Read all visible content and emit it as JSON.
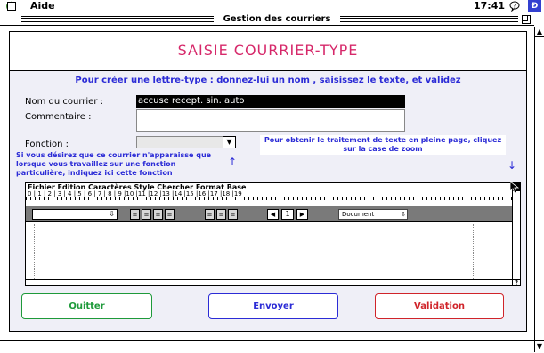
{
  "menubar": {
    "menu_aide": "Aide",
    "clock": "17:41",
    "app_icon_label": "Ð"
  },
  "window": {
    "title": "Gestion des courriers"
  },
  "form": {
    "title": "SAISIE COURRIER-TYPE",
    "instruction": "Pour créer une lettre-type :  donnez-lui un nom , saisissez le texte, et validez",
    "nom_label": "Nom du courrier :",
    "nom_value": "accuse recept. sin. auto",
    "commentaire_label": "Commentaire :",
    "commentaire_value": "",
    "fonction_label": "Fonction :",
    "fonction_value": "",
    "help_left": "Si vous désirez que ce courrier n'apparaisse que lorsque vous travaillez sur une fonction particulière, indiquez ici cette fonction",
    "help_right": "Pour obtenir le traitement de texte en pleine page, cliquez sur la case de zoom"
  },
  "editor": {
    "menu": "Fichier Edition Caractères Style Chercher Format Base",
    "ruler_numbers": "0 | 1 | 2 | 3 | 4 | 5 | 6 | 7 | 8 | 9 |10 |11 |12 |13 |14 |15 |16 |17 |18 |19",
    "style_popup": "⇩",
    "size_value": "1",
    "doc_popup": "Document",
    "help_label": "?"
  },
  "buttons": {
    "quitter": "Quitter",
    "envoyer": "Envoyer",
    "validation": "Validation"
  },
  "colors": {
    "title": "#d6286a",
    "instruction": "#2b2bd6",
    "quitter": "#1e9a3a",
    "envoyer": "#2b2bd6",
    "validation": "#d0242a"
  },
  "icons": {
    "apple": "apple-menu-icon",
    "help": "balloon-help-icon",
    "app": "application-icon"
  }
}
